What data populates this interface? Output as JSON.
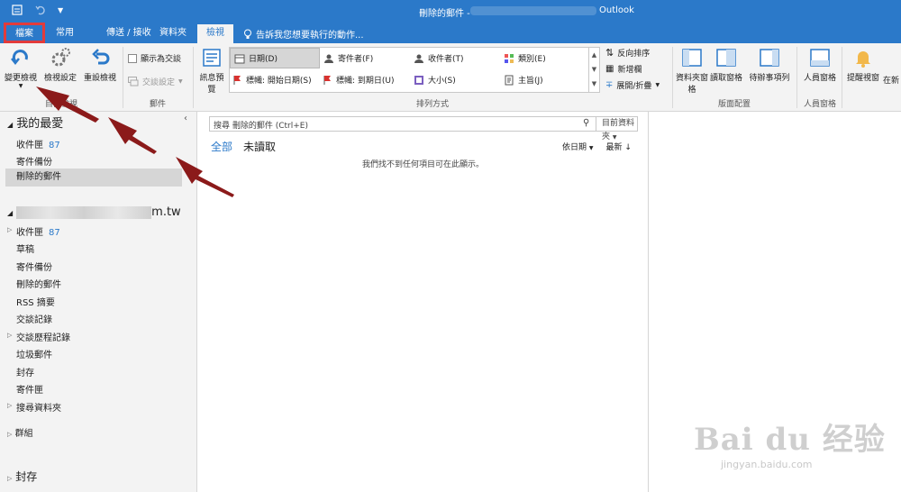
{
  "titlebar": {
    "title": "刪除的郵件 -",
    "app": "Outlook",
    "icons": [
      "send-receive-icon",
      "undo-icon",
      "customize-qat-icon"
    ]
  },
  "tabs": {
    "file": "檔案",
    "home": "常用",
    "send_receive": "傳送 / 接收",
    "folder": "資料夾",
    "view": "檢視",
    "tell_me": "告訴我您想要執行的動作..."
  },
  "ribbon": {
    "current_view": {
      "change_view": "變更檢視",
      "view_settings": "檢視設定",
      "reset_view": "重設檢視",
      "label": "目前檢視"
    },
    "messages": {
      "show_as_conversations": "顯示為交談",
      "conversation_settings": "交談設定",
      "label": "郵件"
    },
    "arrangement": {
      "message_preview": "訊息預覽",
      "items": [
        "日期(D)",
        "寄件者(F)",
        "收件者(T)",
        "類別(E)",
        "標幟: 開始日期(S)",
        "標幟: 到期日(U)",
        "大小(S)",
        "主旨(J)"
      ],
      "reverse_sort": "反向排序",
      "add_columns": "新增欄",
      "expand_collapse": "展開/折疊",
      "label": "排列方式"
    },
    "layout": {
      "folder_pane": "資料夾窗格",
      "reading_pane": "讀取窗格",
      "todo_bar": "待辦事項列",
      "label": "版面配置"
    },
    "people_pane": {
      "people_pane": "人員窗格",
      "label": "人員窗格"
    },
    "window": {
      "reminders": "提醒視窗",
      "open_new": "在新"
    }
  },
  "folders": {
    "favorites_header": "我的最愛",
    "favorites": [
      {
        "name": "收件匣",
        "count": "87"
      },
      {
        "name": "寄件備份",
        "count": ""
      },
      {
        "name": "刪除的郵件",
        "count": ""
      }
    ],
    "account_suffix": "m.tw",
    "account_items": [
      {
        "name": "收件匣",
        "count": "87"
      },
      {
        "name": "草稿",
        "count": ""
      },
      {
        "name": "寄件備份",
        "count": ""
      },
      {
        "name": "刪除的郵件",
        "count": ""
      },
      {
        "name": "RSS 摘要",
        "count": ""
      },
      {
        "name": "交談記錄",
        "count": ""
      },
      {
        "name": "交談歷程記錄",
        "count": ""
      },
      {
        "name": "垃圾郵件",
        "count": ""
      },
      {
        "name": "封存",
        "count": ""
      },
      {
        "name": "寄件匣",
        "count": ""
      },
      {
        "name": "搜尋資料夾",
        "count": ""
      }
    ],
    "groups": "群組",
    "archive": "封存"
  },
  "messages": {
    "search_placeholder": "搜尋 刪除的郵件 (Ctrl+E)",
    "search_scope": "目前資料夾",
    "filter_all": "全部",
    "filter_unread": "未讀取",
    "sort_by": "依日期",
    "sort_order": "最新 ↓",
    "empty_text": "我們找不到任何項目可在此顯示。"
  },
  "watermark": {
    "brand": "Bai du 经验",
    "url": "jingyan.baidu.com"
  },
  "colors": {
    "accent": "#2b79c9",
    "highlight": "#e23b3b",
    "arrow": "#8b1a1a"
  }
}
